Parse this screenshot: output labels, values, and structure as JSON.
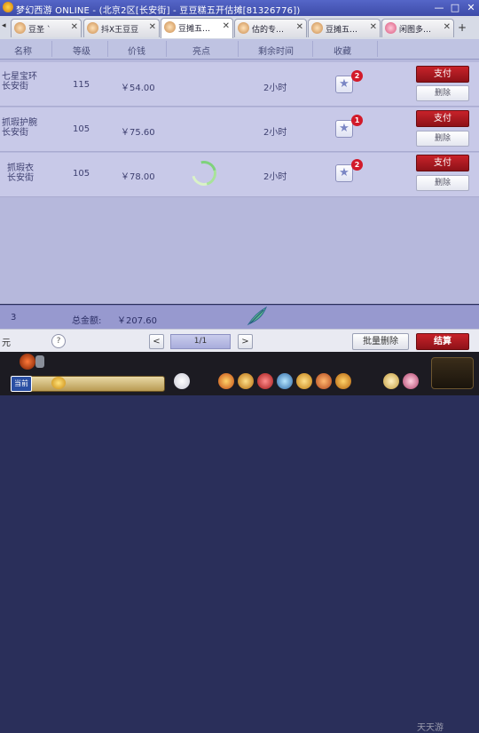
{
  "window": {
    "title": "梦幻西游 ONLINE - (北京2区[长安街] - 豆豆糕五开估摊[81326776])",
    "controls": [
      "—",
      "□",
      "✕"
    ]
  },
  "tabs": [
    {
      "label": "豆圣 `",
      "active": false
    },
    {
      "label": "抖X王豆豆",
      "active": false
    },
    {
      "label": "豆摊五…",
      "active": true
    },
    {
      "label": "估的专…",
      "active": false
    },
    {
      "label": "豆摊五…",
      "active": false
    },
    {
      "label": "闲图多…",
      "active": false
    }
  ],
  "table": {
    "columns": [
      "名称",
      "等级",
      "价钱",
      "亮点",
      "剩余时间",
      "收藏"
    ],
    "rows": [
      {
        "name_line1": "七星宝环",
        "name_line2": "长安街",
        "level": "115",
        "price": "￥54.00",
        "time": "2小时",
        "fav_count": "2",
        "pay": "支付",
        "remove": "删除"
      },
      {
        "name_line1": "抓瑕护腕",
        "name_line2": "长安街",
        "level": "105",
        "price": "￥75.60",
        "time": "2小时",
        "fav_count": "1",
        "pay": "支付",
        "remove": "删除"
      },
      {
        "name_line1": "抓瑕衣",
        "name_line2": "长安街",
        "level": "105",
        "price": "￥78.00",
        "time": "2小时",
        "fav_count": "2",
        "pay": "支付",
        "remove": "删除"
      }
    ]
  },
  "summary": {
    "count": "3",
    "total_label": "总金额:",
    "total_amount": "￥207.60"
  },
  "pager": {
    "left_text": "元",
    "help": "?",
    "prev": "<",
    "page": "1/1",
    "next": ">",
    "batch_delete": "批量删除",
    "settle": "结算"
  },
  "game": {
    "current_channel": "当前",
    "watermark": "天天游"
  },
  "colors": {
    "accent_red": "#b0181f",
    "list_bg": "#c8c9e8",
    "summary_bg": "#9799cf"
  },
  "icons": [
    "star-icon",
    "feather-icon",
    "help-icon",
    "spinner-icon"
  ]
}
